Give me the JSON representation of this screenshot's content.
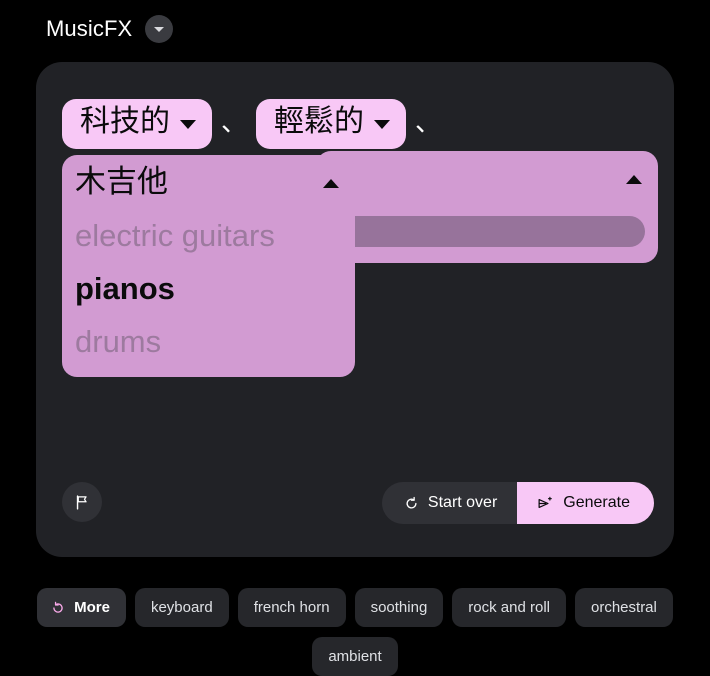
{
  "header": {
    "app_title": "MusicFX",
    "menu_icon": "chevron-down-icon"
  },
  "prompt": {
    "chips": [
      {
        "label": "科技的",
        "caret": "chevron-down-icon"
      },
      {
        "label": "輕鬆的",
        "caret": "chevron-down-icon"
      }
    ],
    "separator": "、"
  },
  "dropdown_front": {
    "selected_label": "木吉他",
    "caret": "chevron-up-icon",
    "options": [
      {
        "label": "electric guitars",
        "state": "normal"
      },
      {
        "label": "pianos",
        "state": "highlighted"
      },
      {
        "label": "drums",
        "state": "normal"
      }
    ]
  },
  "dropdown_back": {
    "caret": "chevron-up-icon"
  },
  "actions": {
    "flag_icon": "flag-icon",
    "start_over_label": "Start over",
    "start_over_icon": "refresh-icon",
    "generate_label": "Generate",
    "generate_icon": "send-sparkle-icon"
  },
  "suggestions": [
    {
      "label": "More",
      "icon": "refresh-icon",
      "primary": true
    },
    {
      "label": "keyboard",
      "icon": "",
      "primary": false
    },
    {
      "label": "french horn",
      "icon": "",
      "primary": false
    },
    {
      "label": "soothing",
      "icon": "",
      "primary": false
    },
    {
      "label": "rock and roll",
      "icon": "",
      "primary": false
    },
    {
      "label": "orchestral",
      "icon": "",
      "primary": false
    },
    {
      "label": "ambient",
      "icon": "",
      "primary": false
    }
  ],
  "colors": {
    "background": "#000000",
    "card": "#212226",
    "chip_pink": "#f8c8f6",
    "dropdown_purple": "#d29bd2",
    "pill_purple": "#97739b",
    "button_dark": "#303136",
    "accent_pink": "#f8a8e8"
  }
}
